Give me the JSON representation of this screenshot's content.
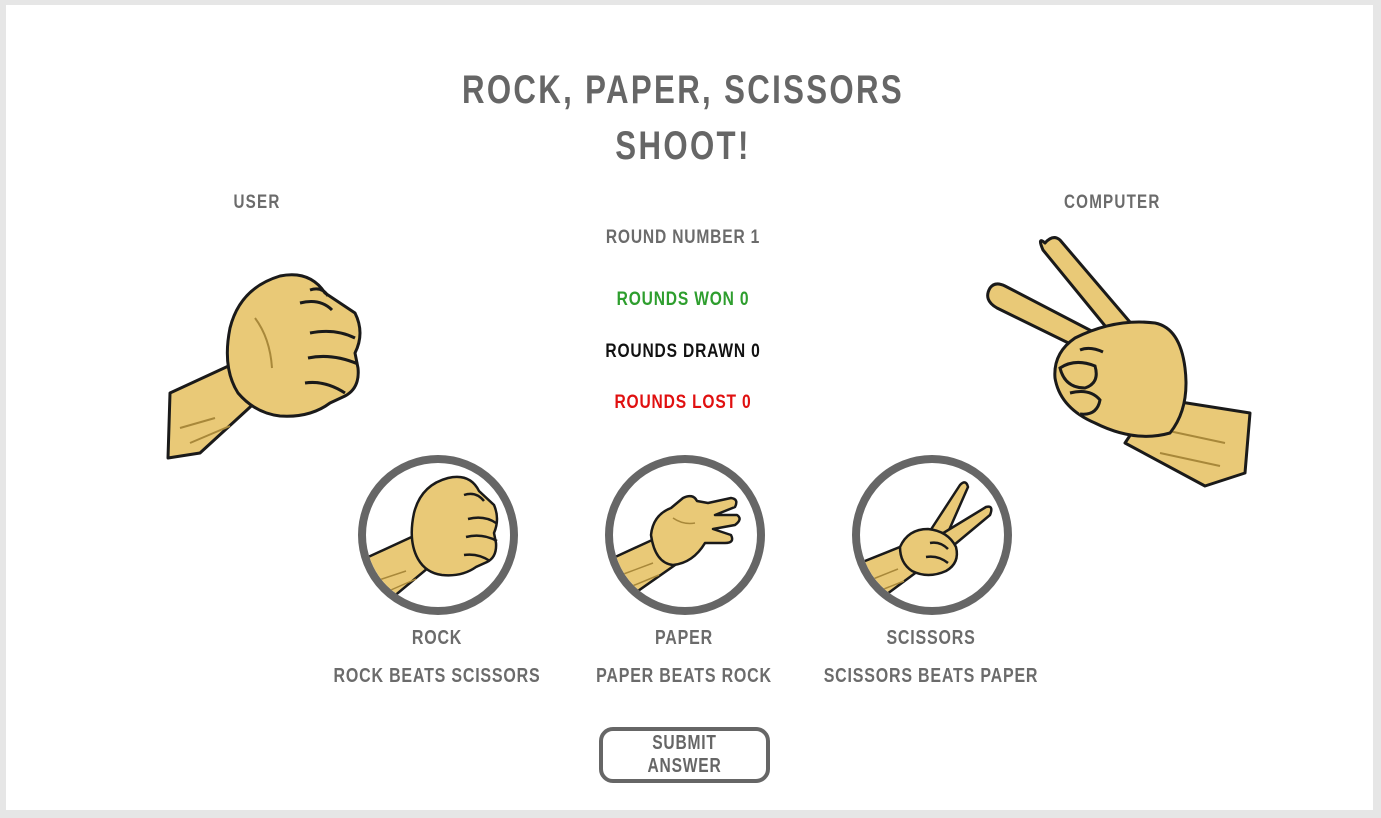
{
  "header": {
    "title_line1": "ROCK, PAPER, SCISSORS",
    "title_line2": "SHOOT!"
  },
  "players": {
    "user_label": "USER",
    "computer_label": "COMPUTER",
    "user_hand": "rock-hand-icon",
    "computer_hand": "scissors-hand-icon"
  },
  "score": {
    "round": "ROUND NUMBER 1",
    "won": "ROUNDS WON 0",
    "drawn": "ROUNDS DRAWN 0",
    "lost": "ROUNDS LOST 0"
  },
  "choices": [
    {
      "name": "ROCK",
      "description": "ROCK BEATS SCISSORS",
      "icon": "rock-hand-icon"
    },
    {
      "name": "PAPER",
      "description": "PAPER BEATS ROCK",
      "icon": "paper-hand-icon"
    },
    {
      "name": "SCISSORS",
      "description": "SCISSORS BEATS PAPER",
      "icon": "scissors-hand-icon"
    }
  ],
  "submit_label": "SUBMIT ANSWER",
  "colors": {
    "text": "#666666",
    "won": "#2e9e2e",
    "drawn": "#111111",
    "lost": "#e01010",
    "skin": "#e9c977",
    "outline": "#1a1a1a"
  }
}
